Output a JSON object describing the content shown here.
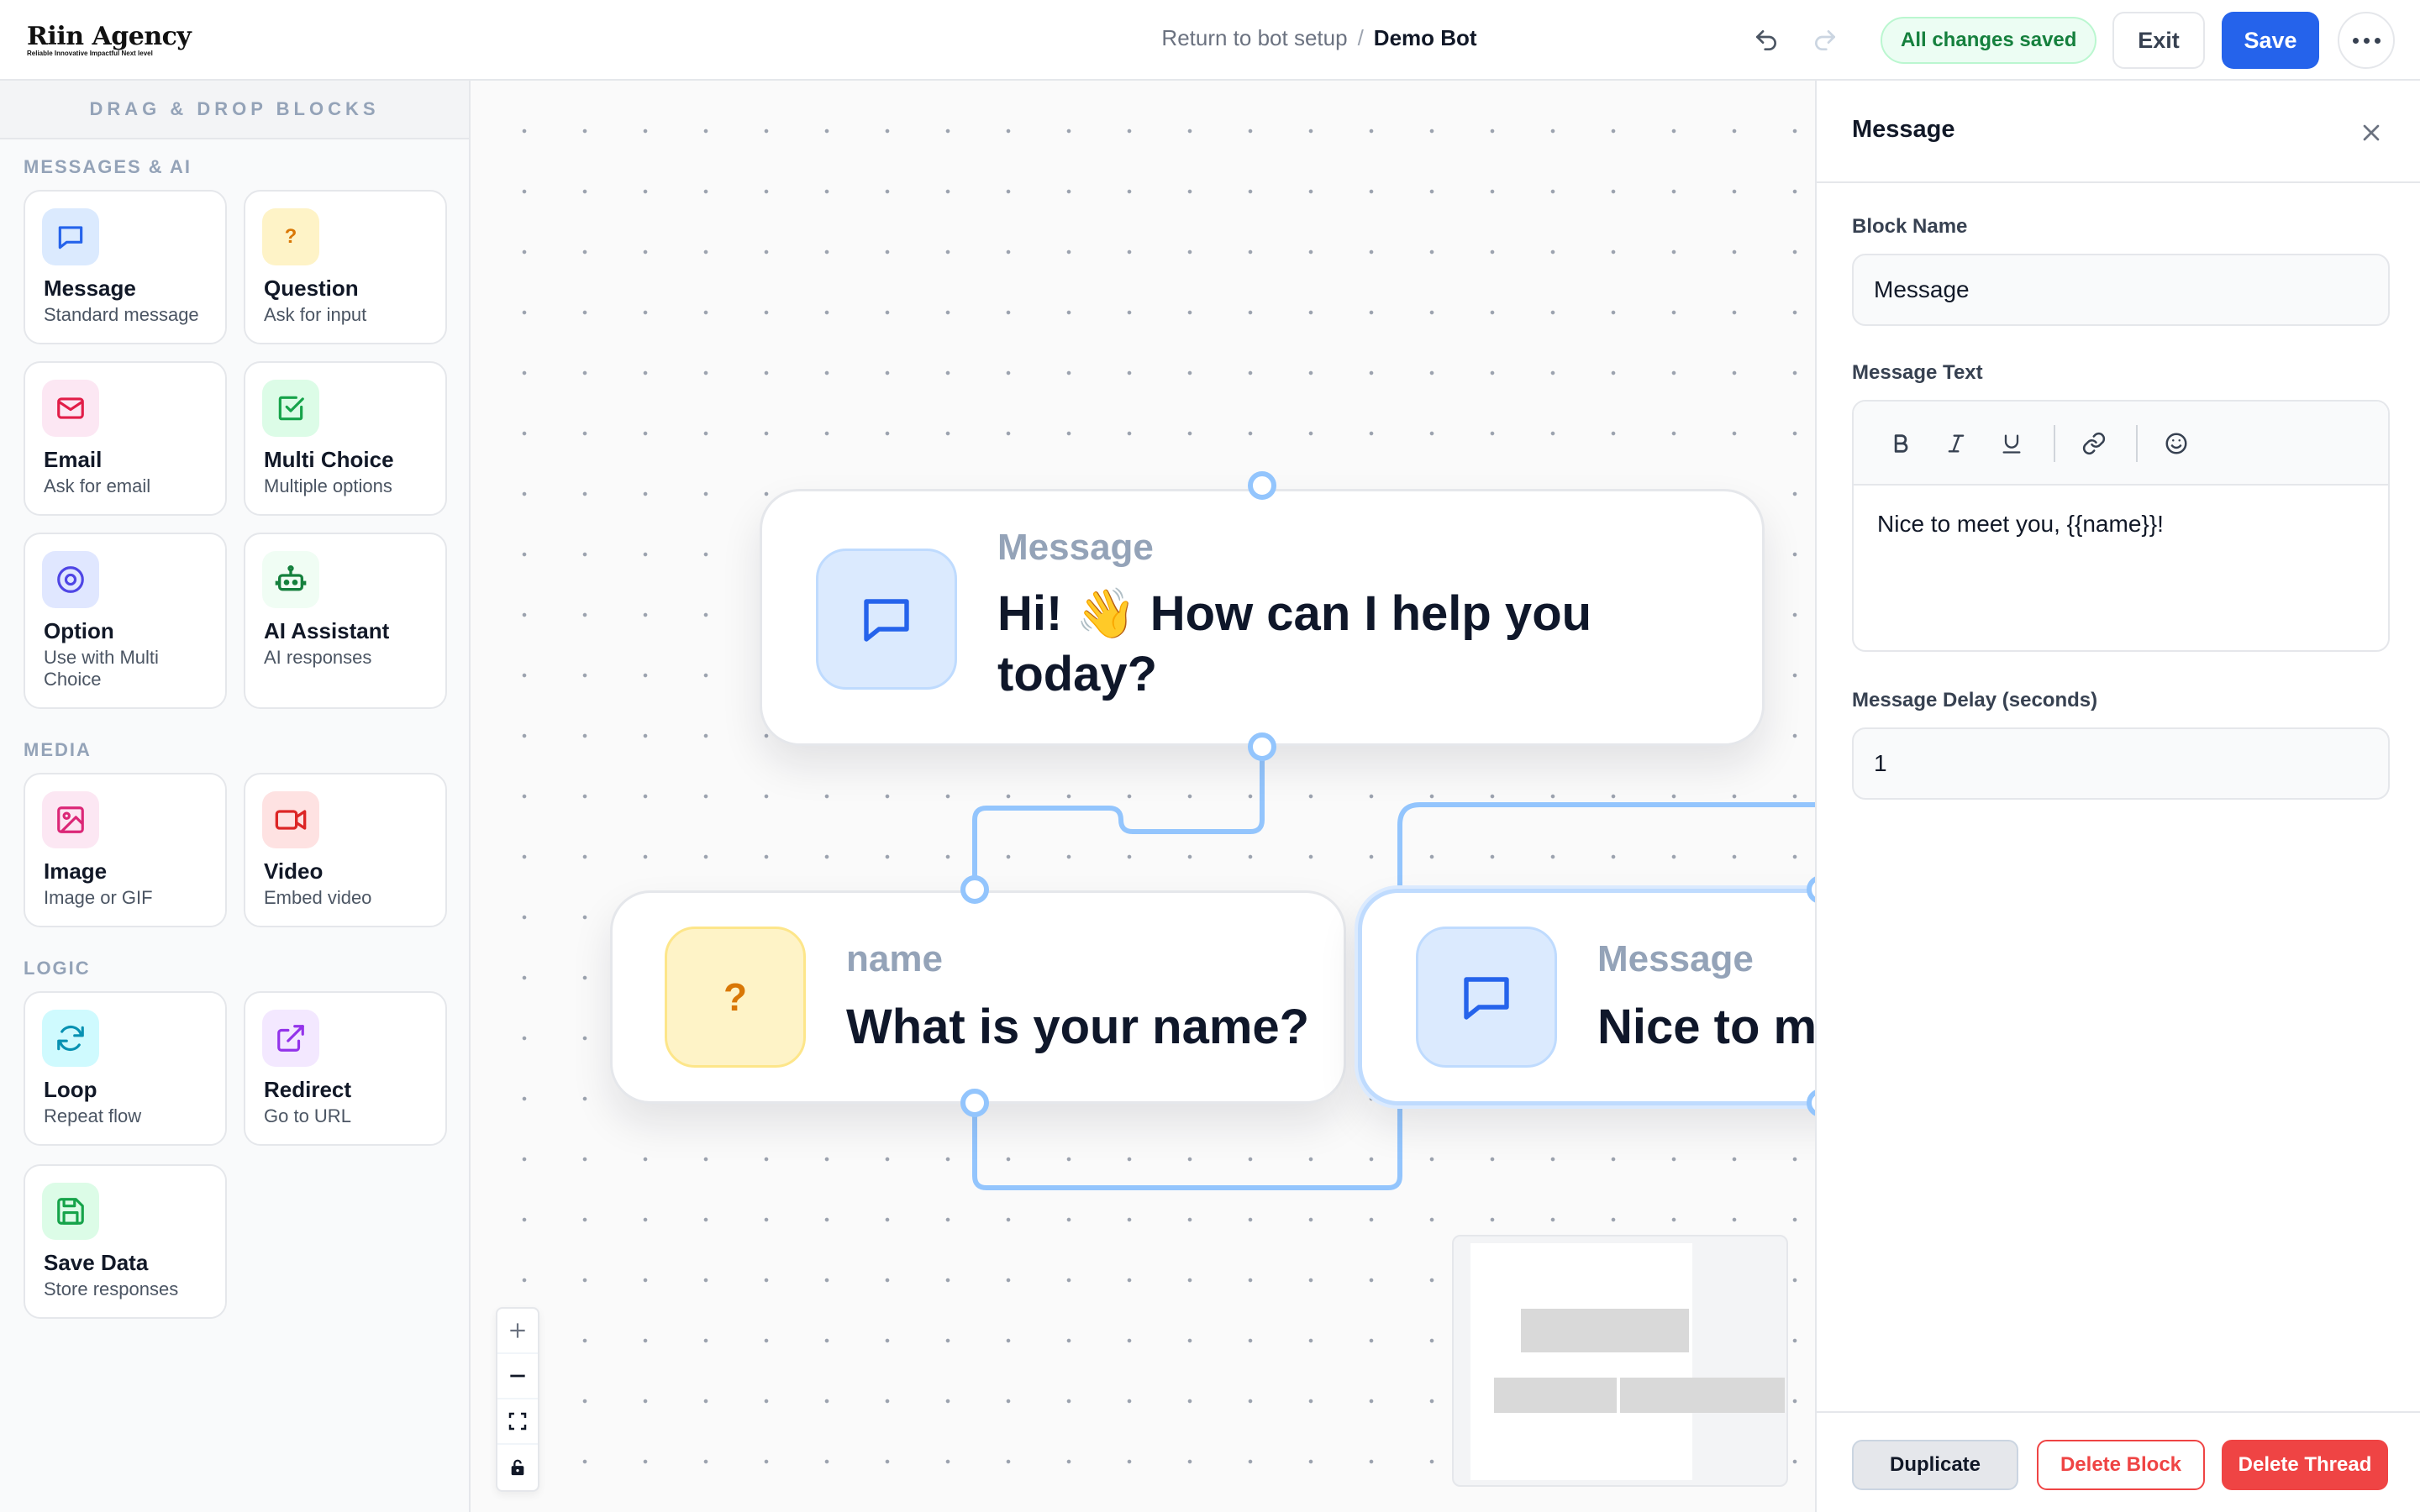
{
  "brand": {
    "name": "Riin Agency",
    "tagline": "Reliable Innovative Impactful Next level"
  },
  "header": {
    "breadcrumb_link": "Return to bot setup",
    "breadcrumb_separator": "/",
    "breadcrumb_current": "Demo Bot",
    "status": "All changes saved",
    "exit_label": "Exit",
    "save_label": "Save"
  },
  "sidebar": {
    "title": "DRAG & DROP BLOCKS",
    "sections": [
      {
        "label": "MESSAGES & AI",
        "blocks": [
          {
            "title": "Message",
            "subtitle": "Standard message",
            "icon": "chat-icon",
            "color": "#2563eb"
          },
          {
            "title": "Question",
            "subtitle": "Ask for input",
            "icon": "question-icon",
            "color": "#d97706"
          },
          {
            "title": "Email",
            "subtitle": "Ask for email",
            "icon": "mail-icon",
            "color": "#e11d48"
          },
          {
            "title": "Multi Choice",
            "subtitle": "Multiple options",
            "icon": "check-square-icon",
            "color": "#16a34a"
          },
          {
            "title": "Option",
            "subtitle": "Use with Multi Choice",
            "icon": "radio-icon",
            "color": "#4f46e5"
          },
          {
            "title": "AI Assistant",
            "subtitle": "AI responses",
            "icon": "robot-icon",
            "color": "#15803d"
          }
        ]
      },
      {
        "label": "MEDIA",
        "blocks": [
          {
            "title": "Image",
            "subtitle": "Image or GIF",
            "icon": "image-icon",
            "color": "#db2777"
          },
          {
            "title": "Video",
            "subtitle": "Embed video",
            "icon": "video-icon",
            "color": "#dc2626"
          }
        ]
      },
      {
        "label": "LOGIC",
        "blocks": [
          {
            "title": "Loop",
            "subtitle": "Repeat flow",
            "icon": "loop-icon",
            "color": "#0891b2"
          },
          {
            "title": "Redirect",
            "subtitle": "Go to URL",
            "icon": "external-link-icon",
            "color": "#9333ea"
          },
          {
            "title": "Save Data",
            "subtitle": "Store responses",
            "icon": "save-icon",
            "color": "#16a34a"
          }
        ]
      }
    ]
  },
  "canvas": {
    "nodes": [
      {
        "kicker": "Message",
        "text_line1": "Hi! 👋  How can I help you",
        "text_line2": "today?",
        "icon": "chat-icon"
      },
      {
        "kicker": "name",
        "text_line1": "What is your name?",
        "icon": "question-icon"
      },
      {
        "kicker": "Message",
        "text_line1": "Nice to m",
        "icon": "chat-icon"
      }
    ]
  },
  "panel": {
    "title": "Message",
    "block_name_label": "Block Name",
    "block_name_value": "Message",
    "message_text_label": "Message Text",
    "message_text_value": "Nice to meet you, {{name}}!",
    "delay_label": "Message Delay (seconds)",
    "delay_value": "1",
    "duplicate_label": "Duplicate",
    "delete_block_label": "Delete Block",
    "delete_thread_label": "Delete Thread"
  },
  "colors": {
    "accent": "#2563eb",
    "danger": "#ef4444",
    "success": "#15803d",
    "wire": "#93c5fd"
  }
}
